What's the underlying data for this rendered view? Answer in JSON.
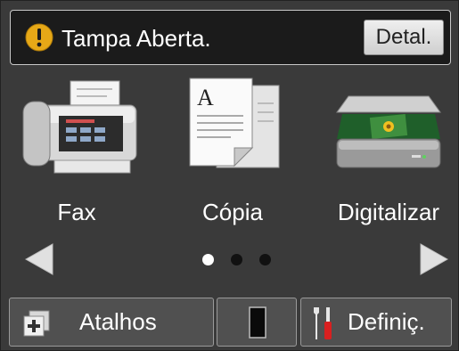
{
  "status": {
    "icon": "warning-icon",
    "message": "Tampa Aberta.",
    "detail_label": "Detal."
  },
  "apps": [
    {
      "label": "Fax",
      "icon": "fax-icon"
    },
    {
      "label": "Cópia",
      "icon": "copy-icon"
    },
    {
      "label": "Digitalizar",
      "icon": "scanner-icon"
    }
  ],
  "pager": {
    "pages": 3,
    "current": 1
  },
  "bottom_bar": {
    "shortcuts_label": "Atalhos",
    "shortcuts_icon": "shortcuts-plus-icon",
    "toner_icon": "toner-icon",
    "settings_label": "Definiç.",
    "settings_icon": "settings-tools-icon"
  },
  "colors": {
    "warning": "#e6a817",
    "screen_bg": "#3a3a3a",
    "status_bg": "#1b1b1b"
  }
}
